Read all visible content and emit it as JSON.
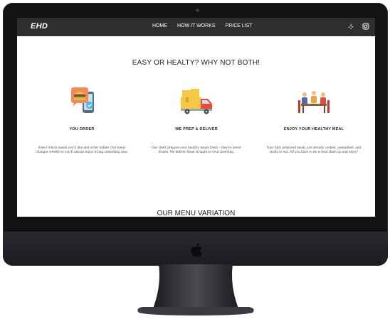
{
  "nav": {
    "brand": "EHD",
    "links": [
      "HOME",
      "HOW IT WORKS",
      "PRICE LIST"
    ],
    "icons": [
      "yelp-icon",
      "instagram-icon"
    ]
  },
  "main": {
    "title": "EASY OR HEALTY? WHY NOT BOTH!",
    "features": [
      {
        "title": "YOU ORDER",
        "text": "Select which meals you'd like and order online. Our menu changes weekly so you'll always enjoy trying something new.",
        "icon": "burger-order-icon"
      },
      {
        "title": "WE PREP & DELIVER",
        "text": "Our chefs prepare your healthy meals fresh – they're never frozen. We deliver them straight to your doorstep.",
        "icon": "delivery-truck-icon"
      },
      {
        "title": "ENJOY YOUR HEALTHY MEAL",
        "text": "Your fully prepared meals are already cooked, assembled, and ready to eat. All you have to do is heat them up and enjoy!",
        "icon": "dining-people-icon"
      }
    ],
    "menu_title": "OUR MENU VARIATION"
  },
  "colors": {
    "nav_bg": "#2f2f2f",
    "monitor": "#111214",
    "page_bg": "#ffffff"
  }
}
